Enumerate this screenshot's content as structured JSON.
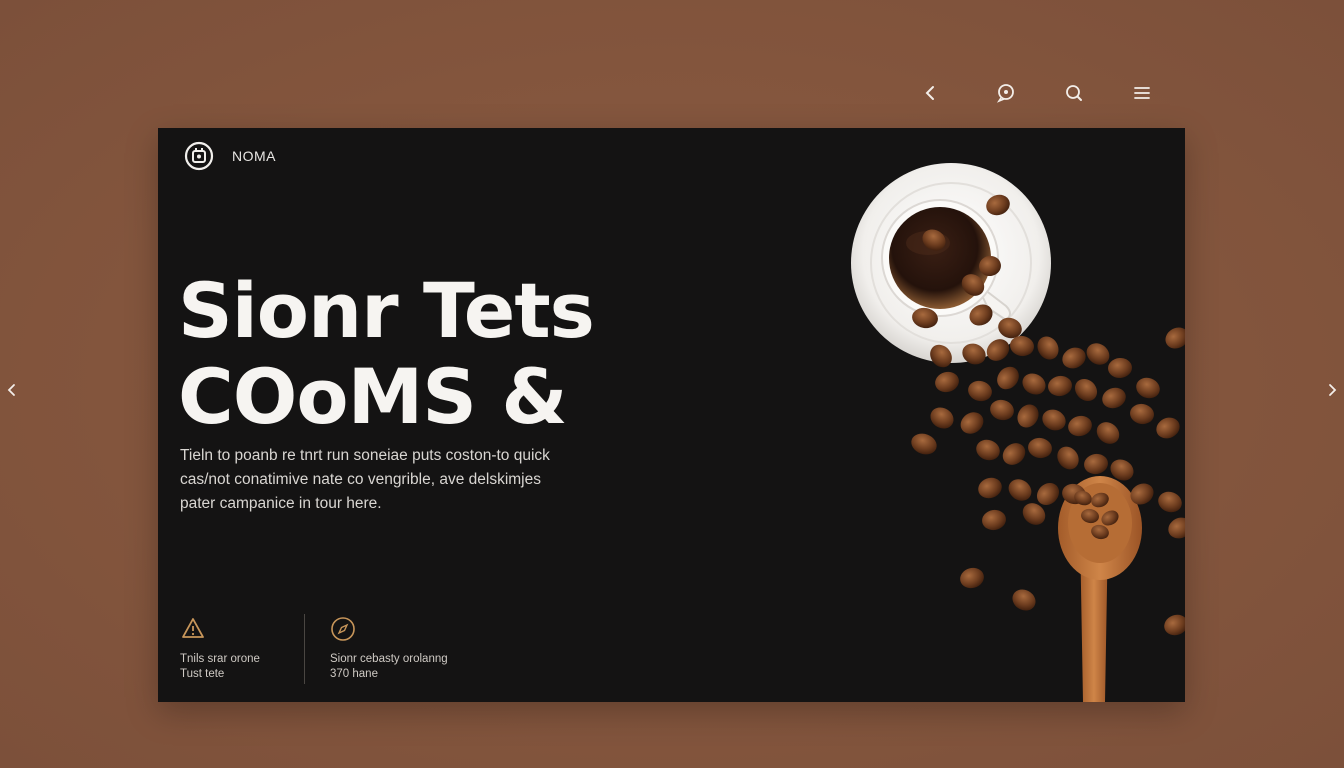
{
  "toolbar": {
    "icons": [
      "back-icon",
      "chat-icon",
      "search-icon",
      "menu-icon"
    ]
  },
  "nav": {
    "prev_icon": "chevron-left-icon",
    "next_icon": "chevron-right-icon"
  },
  "hero": {
    "brand": "NOMA",
    "headline_line1": "Sionr Tets",
    "headline_line2": "COoMS &",
    "description_line1": "Tieln to poanb re tnrt run soneiae puts coston-to quick",
    "description_line2": "cas/not conatimive nate co vengrible, ave delskimjes",
    "description_line3": "pater campanice in tour here."
  },
  "features": [
    {
      "icon": "warning-icon",
      "line1": "Tnils srar orone",
      "line2": "Tust tete"
    },
    {
      "icon": "compass-icon",
      "line1": "Sionr cebasty orolanng",
      "line2": "370 hane"
    }
  ],
  "colors": {
    "background": "#85563e",
    "card": "#141313",
    "text": "#f6f4f1",
    "accent": "#c8965a"
  }
}
